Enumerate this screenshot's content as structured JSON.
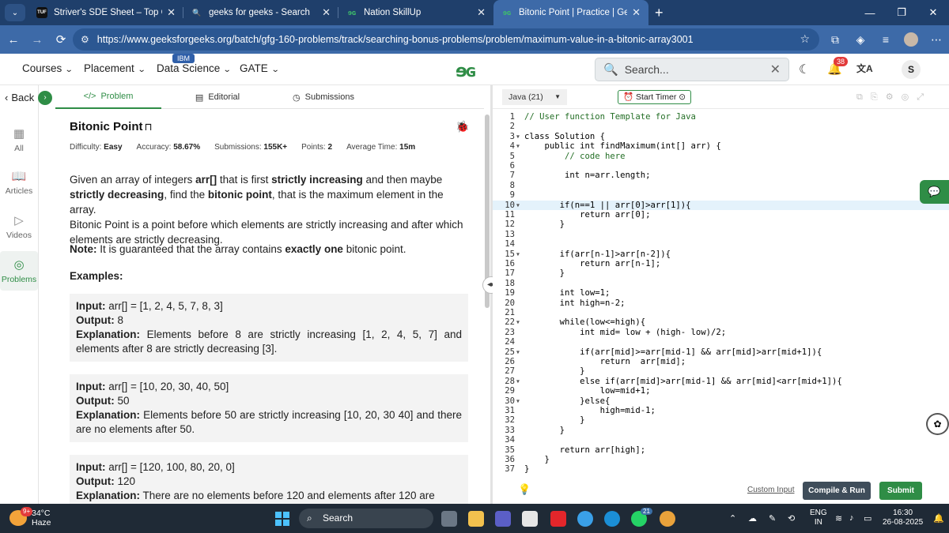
{
  "browser": {
    "tabs": [
      {
        "title": "Striver's SDE Sheet – Top Coding",
        "fav": "tuf",
        "fav_text": "TUF"
      },
      {
        "title": "geeks for geeks - Search",
        "fav": "search-icon",
        "fav_text": "🔍"
      },
      {
        "title": "Nation SkillUp",
        "fav": "gfg",
        "fav_text": "ɘɢ"
      },
      {
        "title": "Bitonic Point | Practice | Geeksfo",
        "fav": "gfg",
        "fav_text": "ɘɢ"
      }
    ],
    "url": "https://www.geeksforgeeks.org/batch/gfg-160-problems/track/searching-bonus-problems/problem/maximum-value-in-a-bitonic-array3001"
  },
  "nav": {
    "items": [
      "Courses",
      "Placement",
      "Data Science",
      "GATE"
    ],
    "ibm_badge": "IBM",
    "logo": "ɘɢ",
    "search_placeholder": "Search...",
    "notif_count": "38",
    "avatar_letter": "S"
  },
  "sidebar": {
    "back": "Back",
    "items": [
      "All",
      "Articles",
      "Videos",
      "Problems"
    ]
  },
  "problem_tabs": [
    "Problem",
    "Editorial",
    "Submissions"
  ],
  "problem": {
    "title": "Bitonic Point",
    "meta": [
      {
        "label": "Difficulty:",
        "value": "Easy"
      },
      {
        "label": "Accuracy:",
        "value": "58.67%"
      },
      {
        "label": "Submissions:",
        "value": "155K+"
      },
      {
        "label": "Points:",
        "value": "2"
      },
      {
        "label": "Average Time:",
        "value": "15m"
      }
    ],
    "desc_1": "Given an array of integers ",
    "desc_arr": "arr[]",
    "desc_2": " that is first ",
    "desc_si": "strictly increasing",
    "desc_3": " and then maybe ",
    "desc_sd": "strictly decreasing",
    "desc_4": ", find the ",
    "desc_bp": "bitonic point",
    "desc_5": ", that is the maximum element in the array.",
    "desc_6": "Bitonic Point is a point before which elements are strictly increasing and after which elements are strictly decreasing.",
    "note_label": "Note:",
    "note_1": " It is guaranteed that the array contains ",
    "note_bold": "exactly one",
    "note_2": " bitonic point.",
    "examples_label": "Examples:",
    "examples": [
      {
        "input": "arr[] = [1, 2, 4, 5, 7, 8, 3]",
        "output": "8",
        "explanation": "Elements before 8 are strictly increasing [1, 2, 4, 5, 7] and elements after 8 are strictly decreasing [3]."
      },
      {
        "input": "arr[] = [10, 20, 30, 40, 50]",
        "output": "50",
        "explanation": "Elements before 50 are strictly increasing [10, 20, 30 40] and there are no elements after 50."
      },
      {
        "input": "arr[] = [120, 100, 80, 20, 0]",
        "output": "120",
        "explanation": "There are no elements before 120 and elements after 120 are"
      }
    ],
    "input_label": "Input:",
    "output_label": "Output:",
    "explanation_label": "Explanation:"
  },
  "editor": {
    "language": "Java (21)",
    "timer": "Start Timer",
    "lines": [
      "// User function Template for Java",
      "",
      "class Solution {",
      "    public int findMaximum(int[] arr) {",
      "        // code here",
      "",
      "        int n=arr.length;",
      "",
      "",
      "       if(n==1 || arr[0]>arr[1]){",
      "           return arr[0];",
      "       }",
      "",
      "",
      "       if(arr[n-1]>arr[n-2]){",
      "           return arr[n-1];",
      "       }",
      "",
      "       int low=1;",
      "       int high=n-2;",
      "",
      "       while(low<=high){",
      "           int mid= low + (high- low)/2;",
      "",
      "           if(arr[mid]>=arr[mid-1] && arr[mid]>arr[mid+1]){",
      "               return  arr[mid];",
      "           }",
      "           else if(arr[mid]>arr[mid-1] && arr[mid]<arr[mid+1]){",
      "               low=mid+1;",
      "           }else{",
      "               high=mid-1;",
      "           }",
      "       }",
      "",
      "       return arr[high];",
      "    }",
      "}"
    ],
    "custom_input": "Custom Input",
    "compile_run": "Compile & Run",
    "submit": "Submit"
  },
  "taskbar": {
    "temp": "34°C",
    "weather": "Haze",
    "weather_badge": "9+",
    "search": "Search",
    "lang_1": "ENG",
    "lang_2": "IN",
    "time": "16:30",
    "date": "26-08-2025",
    "whatsapp_badge": "21"
  }
}
